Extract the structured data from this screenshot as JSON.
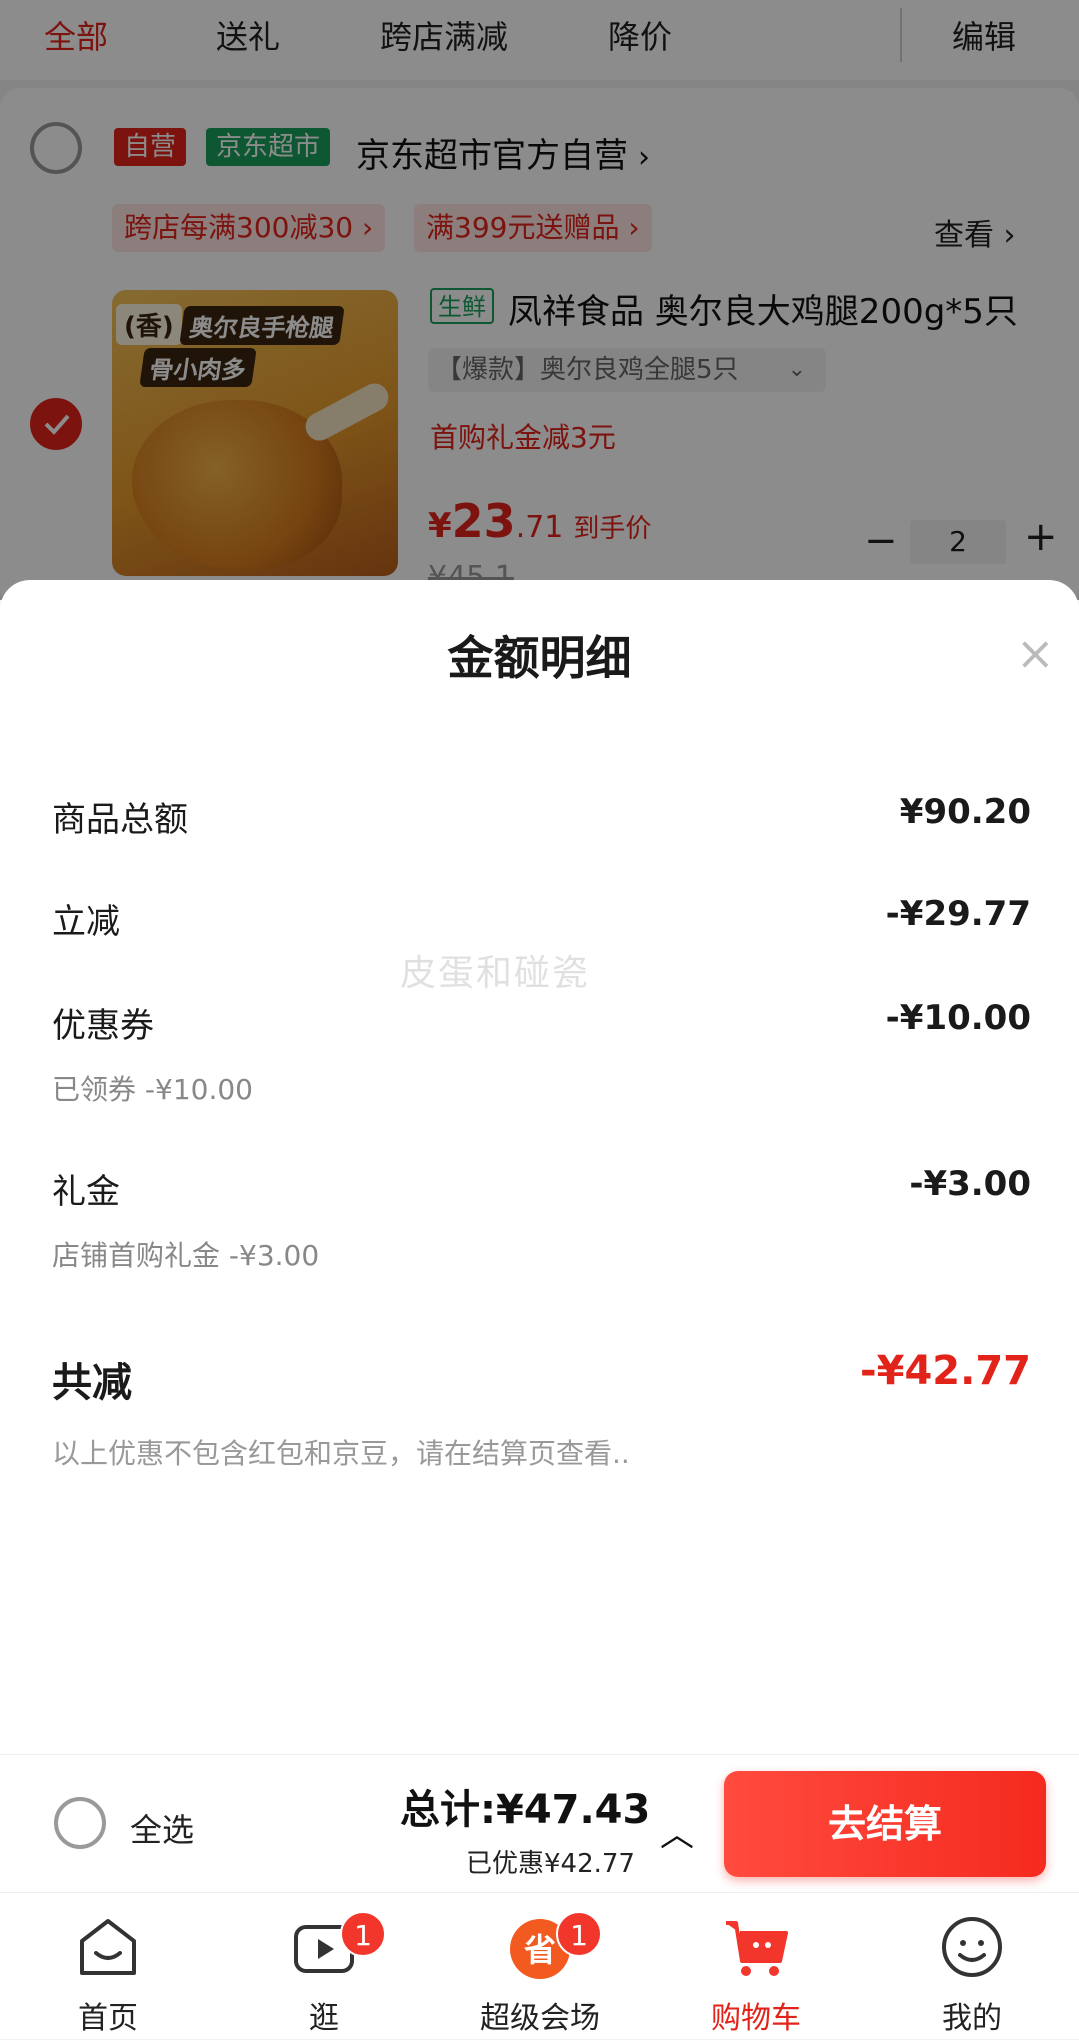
{
  "filter_tabs": [
    "全部",
    "送礼",
    "跨店满减",
    "降价"
  ],
  "edit_label": "编辑",
  "store": {
    "badge_self": "自营",
    "badge_market": "京东超市",
    "name": "京东超市官方自营",
    "promo_tags": [
      "跨店每满300减30 ›",
      "满399元送赠品 ›"
    ],
    "view_label": "查看 ›"
  },
  "product": {
    "image_labels": [
      "(香)",
      "奥尔良手枪腿",
      "骨小肉多"
    ],
    "fresh_tag": "生鲜",
    "title": "凤祥食品 奥尔良大鸡腿200g*5只",
    "spec": "【爆款】奥尔良鸡全腿5只",
    "first_gift": "首购礼金减3元",
    "price_currency": "¥",
    "price_int": "23",
    "price_dec": ".71",
    "price_note": "到手价",
    "old_price": "¥45.1",
    "quantity": "2"
  },
  "sheet": {
    "title": "金额明细",
    "rows": [
      {
        "label": "商品总额",
        "value": "¥90.20"
      },
      {
        "label": "立减",
        "value": "-¥29.77"
      },
      {
        "label": "优惠券",
        "value": "-¥10.00",
        "sub": "已领券 -¥10.00"
      },
      {
        "label": "礼金",
        "value": "-¥3.00",
        "sub": "店铺首购礼金 -¥3.00"
      }
    ],
    "total_label": "共减",
    "total_value": "-¥42.77",
    "note": "以上优惠不包含红包和京豆，请在结算页查看..",
    "watermark": "皮蛋和碰瓷"
  },
  "checkout": {
    "select_all": "全选",
    "total": "总计:¥47.43",
    "saved": "已优惠¥42.77",
    "button": "去结算"
  },
  "nav": [
    {
      "label": "首页",
      "icon": "home-icon"
    },
    {
      "label": "逛",
      "icon": "video-icon",
      "badge": "1"
    },
    {
      "label": "超级会场",
      "icon": "super-venue-icon",
      "badge": "1"
    },
    {
      "label": "购物车",
      "icon": "cart-icon"
    },
    {
      "label": "我的",
      "icon": "profile-icon"
    }
  ],
  "colors": {
    "accent": "#e2231a",
    "green": "#18a05b"
  }
}
